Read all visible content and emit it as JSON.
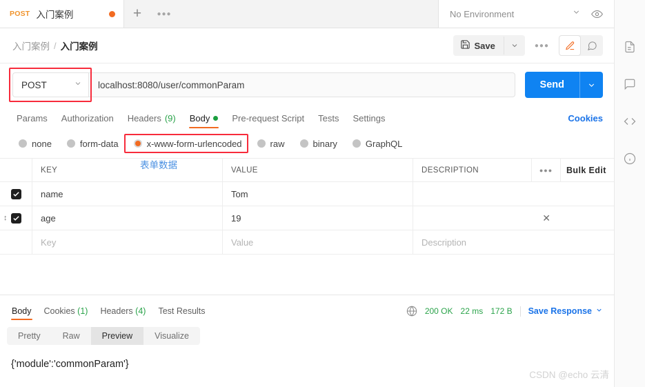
{
  "tabstrip": {
    "tab": {
      "method": "POST",
      "title": "入门案例",
      "unsaved_dot": true
    },
    "new_tab_icon": "plus-icon",
    "more_icon": "ellipsis-icon",
    "environment": {
      "label": "No Environment",
      "caret_icon": "chevron-down-icon"
    },
    "eye_icon": "eye-icon"
  },
  "breadcrumb": {
    "parent": "入门案例",
    "separator": "/",
    "current": "入门案例",
    "save_label": "Save",
    "save_icon": "floppy-disk-icon",
    "save_caret_icon": "chevron-down-icon",
    "more_icon": "ellipsis-icon",
    "edit_icon": "pencil-icon",
    "comment_icon": "comment-icon"
  },
  "url_bar": {
    "method": "POST",
    "method_caret_icon": "chevron-down-icon",
    "url": "localhost:8080/user/commonParam",
    "send_label": "Send",
    "send_caret_icon": "chevron-down-icon"
  },
  "request_tabs": [
    {
      "label": "Params",
      "active": false
    },
    {
      "label": "Authorization",
      "active": false
    },
    {
      "label": "Headers",
      "count": "(9)",
      "active": false
    },
    {
      "label": "Body",
      "dot": true,
      "active": true
    },
    {
      "label": "Pre-request Script",
      "active": false
    },
    {
      "label": "Tests",
      "active": false
    },
    {
      "label": "Settings",
      "active": false
    }
  ],
  "cookies_link": "Cookies",
  "body_types": [
    {
      "label": "none",
      "selected": false
    },
    {
      "label": "form-data",
      "selected": false
    },
    {
      "label": "x-www-form-urlencoded",
      "selected": true
    },
    {
      "label": "raw",
      "selected": false
    },
    {
      "label": "binary",
      "selected": false
    },
    {
      "label": "GraphQL",
      "selected": false
    }
  ],
  "annotation": {
    "text": "表单数据",
    "color": "#4a90e2"
  },
  "kv_table": {
    "headers": {
      "key": "KEY",
      "value": "VALUE",
      "description": "DESCRIPTION",
      "more_icon": "ellipsis-icon",
      "bulk_edit": "Bulk Edit"
    },
    "rows": [
      {
        "checked": true,
        "key": "name",
        "value": "Tom",
        "description": "",
        "has_delete": false
      },
      {
        "checked": true,
        "key": "age",
        "value": "19",
        "description": "",
        "has_delete": true,
        "delete_icon": "close-icon",
        "drag_icon": "drag-handle-icon"
      }
    ],
    "placeholder_row": {
      "key": "Key",
      "value": "Value",
      "description": "Description"
    }
  },
  "response": {
    "tabs": [
      {
        "label": "Body",
        "active": true
      },
      {
        "label": "Cookies",
        "count": "(1)",
        "active": false
      },
      {
        "label": "Headers",
        "count": "(4)",
        "active": false
      },
      {
        "label": "Test Results",
        "active": false
      }
    ],
    "globe_icon": "globe-icon",
    "status": "200 OK",
    "time": "22 ms",
    "size": "172 B",
    "save_response": "Save Response",
    "save_response_caret_icon": "chevron-down-icon",
    "formats": [
      {
        "label": "Pretty",
        "active": false
      },
      {
        "label": "Raw",
        "active": false
      },
      {
        "label": "Preview",
        "active": true
      },
      {
        "label": "Visualize",
        "active": false
      }
    ],
    "body_text": "{'module':'commonParam'}"
  },
  "right_rail": [
    {
      "icon": "document-icon"
    },
    {
      "icon": "comment-icon"
    },
    {
      "icon": "code-icon"
    },
    {
      "icon": "info-icon"
    }
  ],
  "watermark": "CSDN @echo 云清",
  "colors": {
    "accent_orange": "#f26b21",
    "send_blue": "#0f83f2",
    "link_blue": "#1a73e8",
    "status_green": "#2aa34a",
    "highlight_red": "#f72b3b",
    "annotation_blue": "#4a90e2"
  }
}
